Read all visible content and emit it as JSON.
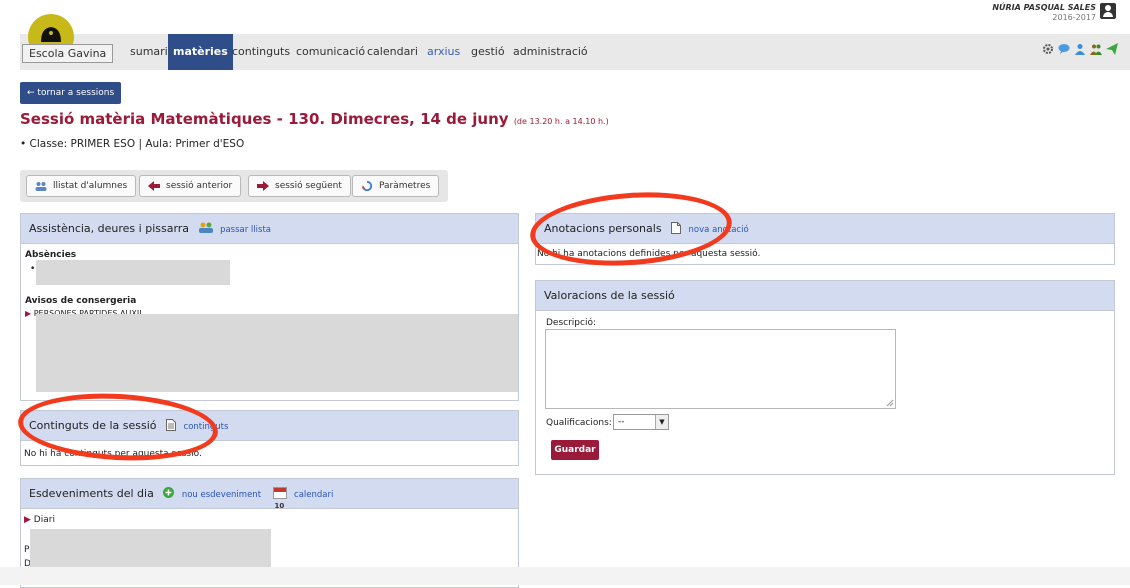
{
  "header": {
    "school_name": "Escola Gavina",
    "user_name": "NÚRIA PASQUAL SALES",
    "school_year": "2016-2017",
    "nav": [
      {
        "label": "sumari",
        "active": false,
        "color": "#333333"
      },
      {
        "label": "matèries",
        "active": true,
        "color": "#ffffff"
      },
      {
        "label": "continguts",
        "active": false,
        "color": "#333333"
      },
      {
        "label": "comunicació",
        "active": false,
        "color": "#333333"
      },
      {
        "label": "calendari",
        "active": false,
        "color": "#333333"
      },
      {
        "label": "arxius",
        "active": false,
        "color": "#3a5fb0"
      },
      {
        "label": "gestió",
        "active": false,
        "color": "#333333"
      },
      {
        "label": "administració",
        "active": false,
        "color": "#333333"
      }
    ],
    "tool_icons": [
      "gear-icon",
      "chat-icon",
      "user-icon",
      "group-icon",
      "send-icon"
    ]
  },
  "back_button": "tornar a sessions",
  "title": {
    "main": "Sessió matèria Matemàtiques - 130. Dimecres, 14 de juny",
    "time": "(de 13.20 h. a 14.10 h.)"
  },
  "class_line": "Classe: PRIMER ESO | Aula: Primer d'ESO",
  "toolbar": {
    "students": "llistat d'alumnes",
    "prev": "sessió anterior",
    "next": "sessió següent",
    "params": "Paràmetres"
  },
  "attendance": {
    "title": "Assistència, deures i pissarra",
    "link": "passar llista",
    "absences_label": "Absències",
    "concierge_label": "Avisos de consergeria",
    "concierge_partial": "PERSONES PARTIDES AUXIL"
  },
  "contents": {
    "title": "Continguts de la sessió",
    "link": "continguts",
    "empty": "No hi ha continguts per aquesta sessió."
  },
  "events": {
    "title": "Esdeveniments del dia",
    "new_link": "nou esdeveniment",
    "calendar_link": "calendari",
    "calendar_day": "10",
    "diary_label": "Diari",
    "row_p": "P",
    "row_d": "D"
  },
  "notes": {
    "title": "Anotacions personals",
    "link": "nova anotació",
    "empty": "No hi ha anotacions definides per aquesta sessió."
  },
  "rating": {
    "title": "Valoracions de la sessió",
    "description_label": "Descripció:",
    "grades_label": "Qualificacions:",
    "grades_value": "--",
    "save": "Guardar"
  },
  "colors": {
    "brand_blue": "#2f4d88",
    "title_red": "#9a1a3a",
    "panel_head": "#d3dbf0",
    "highlight_ring": "#f23a1e"
  }
}
